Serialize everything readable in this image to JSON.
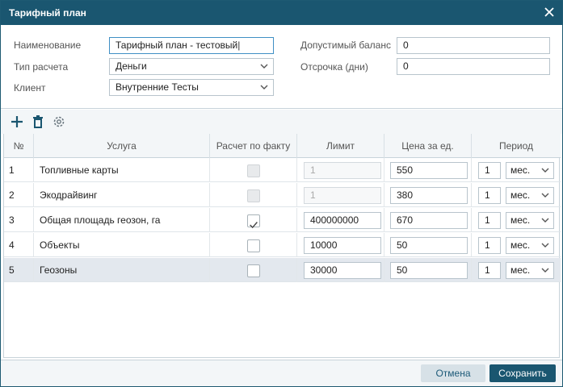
{
  "window": {
    "title": "Тарифный план"
  },
  "form": {
    "name_label": "Наименование",
    "name_value": "Тарифный план - тестовый",
    "calc_type_label": "Тип расчета",
    "calc_type_value": "Деньги",
    "client_label": "Клиент",
    "client_value": "Внутренние Тесты",
    "balance_label": "Допустимый баланс",
    "balance_value": "0",
    "deferral_label": "Отсрочка (дни)",
    "deferral_value": "0"
  },
  "toolbar": {
    "icons": [
      "add-icon",
      "delete-icon",
      "settings-icon"
    ]
  },
  "table": {
    "headers": {
      "num": "№",
      "service": "Услуга",
      "fact": "Расчет по факту",
      "limit": "Лимит",
      "price": "Цена за ед.",
      "period": "Период"
    },
    "rows": [
      {
        "num": "1",
        "service": "Топливные карты",
        "fact_checked": false,
        "fact_disabled": true,
        "limit": "1",
        "limit_disabled": true,
        "price": "550",
        "period_count": "1",
        "period_unit": "мес."
      },
      {
        "num": "2",
        "service": "Экодрайвинг",
        "fact_checked": false,
        "fact_disabled": true,
        "limit": "1",
        "limit_disabled": true,
        "price": "380",
        "period_count": "1",
        "period_unit": "мес."
      },
      {
        "num": "3",
        "service": "Общая площадь геозон, га",
        "fact_checked": true,
        "fact_disabled": false,
        "limit": "400000000",
        "limit_disabled": false,
        "price": "670",
        "period_count": "1",
        "period_unit": "мес."
      },
      {
        "num": "4",
        "service": "Объекты",
        "fact_checked": false,
        "fact_disabled": false,
        "limit": "10000",
        "limit_disabled": false,
        "price": "50",
        "period_count": "1",
        "period_unit": "мес."
      },
      {
        "num": "5",
        "service": "Геозоны",
        "fact_checked": false,
        "fact_disabled": false,
        "limit": "30000",
        "limit_disabled": false,
        "price": "50",
        "period_count": "1",
        "period_unit": "мес."
      }
    ],
    "selected_row": 4
  },
  "footer": {
    "cancel_label": "Отмена",
    "save_label": "Сохранить"
  },
  "colors": {
    "titlebar": "#1a5670",
    "primary_button": "#1a5670",
    "secondary_button": "#d7e1e7",
    "selected_row": "#e3e8ee"
  }
}
